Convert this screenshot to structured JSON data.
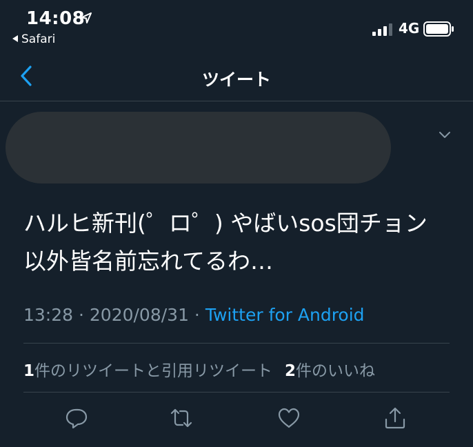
{
  "status_bar": {
    "time": "14:08",
    "location_icon": "location-arrow-icon",
    "back_app_label": "Safari",
    "network": "4G",
    "signal_bars": 3,
    "signal_bars_total": 4,
    "battery_icon": "battery-icon"
  },
  "nav": {
    "title": "ツイート",
    "back_icon": "chevron-left-icon"
  },
  "tweet": {
    "author_redacted": true,
    "menu_icon": "chevron-down-icon",
    "text": "ハルヒ新刊(゜ロ゜) やばいsos団チョン以外皆名前忘れてるわ…",
    "time": "13:28",
    "separator": " · ",
    "date": "2020/08/31",
    "source": "Twitter for Android"
  },
  "stats": {
    "retweets_count": "1",
    "retweets_label": "件のリツイートと引用リツイート",
    "likes_count": "2",
    "likes_label": "件のいいね"
  },
  "actions": [
    "reply-icon",
    "retweet-icon",
    "like-icon",
    "share-icon"
  ],
  "colors": {
    "background": "#15202b",
    "accent": "#1da1f2",
    "secondary_text": "#8899a6",
    "divider": "#38444d"
  }
}
